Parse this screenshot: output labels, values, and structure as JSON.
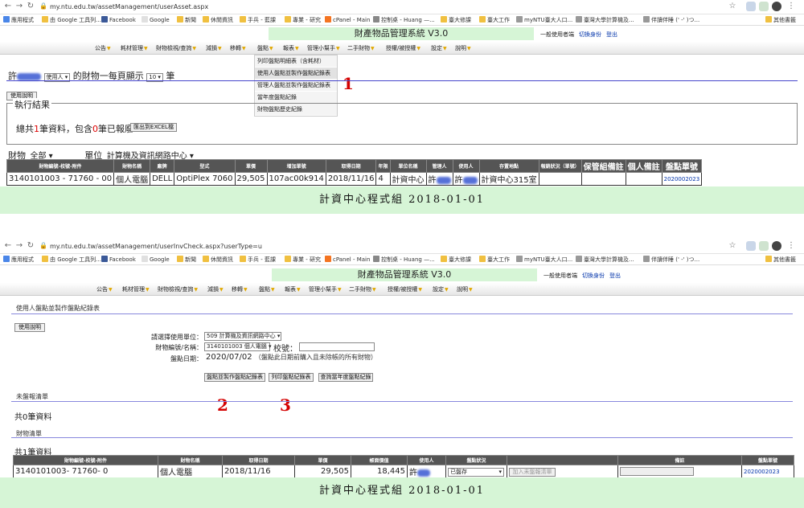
{
  "top": {
    "url": "my.ntu.edu.tw/assetManagement/userAsset.aspx",
    "bookmarks": [
      "應用程式",
      "由 Google 工具列...",
      "Facebook",
      "Google",
      "新聞",
      "休閒資訊",
      "手兵 - 藍課",
      "專業 - 研究",
      "cPanel - Main",
      "控制桌 - Huang —...",
      "臺大修課",
      "臺大工作",
      "myNTU臺大人口...",
      "臺灣大學計算機及...",
      "伴讀伴睡 (' -' )つ...",
      "其他書籤"
    ],
    "title": "財產物品管理系統 V3.0",
    "user_label": "一般使用者端",
    "switch_link": "切換身份",
    "logout_link": "登出",
    "menu": [
      "公告",
      "耗材管理",
      "財物檢視/查詢",
      "減損",
      "移轉",
      "盤點",
      "報表",
      "管理小幫手",
      "二手財物",
      "授權/被授權",
      "設定",
      "說明"
    ],
    "dropdown": [
      "列印盤點明細表（含耗材）",
      "使用人盤點並製作盤點紀錄表",
      "管理人盤點並製作盤點紀錄表",
      "當年度盤點紀錄",
      "財物盤點歷史紀錄"
    ],
    "anno": "1",
    "owner_prefix": "許",
    "role_select": "使用人",
    "owner_mid": "的財物",
    "per_page_label": "一每頁顯示",
    "per_page_value": "10",
    "per_page_unit": "筆",
    "help_btn": "使用說明",
    "result_legend": "執行結果",
    "summary_a": "總共",
    "summary_count": "1",
    "summary_b": "筆資料，包含",
    "summary_scrap": "0",
    "summary_c": "筆已報廢",
    "export_btn": "匯出到EXCEL檔",
    "filter_asset_label": "財物",
    "filter_asset_value": "全部",
    "filter_unit_label": "單位",
    "filter_unit_value": "計算機及資訊網路中心",
    "table_headers": [
      "財物編號-校號-附件",
      "財物名稱",
      "廠牌",
      "型式",
      "單價",
      "增加單號",
      "取得日期",
      "年限",
      "單位名稱",
      "管理人",
      "使用人",
      "存置地點",
      "報銷狀況（單號）"
    ],
    "table_big_headers": [
      "保管組備註",
      "個人備註",
      "盤點單號"
    ],
    "row": [
      "3140101003 - 71760 - 00",
      "個人電腦",
      "DELL",
      "OptiPlex 7060",
      "29,505",
      "107ac00k914",
      "2018/11/16",
      "4",
      "計資中心",
      "許",
      "許",
      "計資中心315室",
      "",
      "",
      "",
      "2020002023"
    ],
    "footer": "計資中心程式組 2018-01-01"
  },
  "bottom": {
    "url": "my.ntu.edu.tw/assetManagement/userInvCheck.aspx?userType=u",
    "title": "財產物品管理系統 V3.0",
    "user_label": "一般使用者端",
    "switch_link": "切換身份",
    "logout_link": "登出",
    "page_heading": "使用人盤點並製作盤點紀錄表",
    "help_btn": "使用說明",
    "unit_label": "請選擇使用單位：",
    "unit_value": "509 計算機及資訊網路中心",
    "asset_label": "財物編號/名稱：",
    "asset_value": "3140101003 個人電腦",
    "school_no_label": "校號：",
    "date_label": "盤點日期：",
    "date_value": "2020/07/02",
    "date_note": "（盤點此日期前購入且未除帳的所有財物）",
    "btn_make": "盤點並製作盤點紀錄表",
    "btn_print": "列印盤點紀錄表",
    "btn_query": "查詢當年度盤點紀錄",
    "anno2": "2",
    "anno3": "3",
    "unchecked_heading": "未盤報清單",
    "unchecked_count": "共0筆資料",
    "list_heading": "財物清單",
    "list_count": "共1筆資料",
    "table_headers": [
      "財物編號-校號-附件",
      "財物名稱",
      "取得日期",
      "單價",
      "帳面價值",
      "使用人",
      "盤點狀況",
      "",
      "備註",
      "盤點單號"
    ],
    "row": [
      "3140101003- 71760- 0",
      "個人電腦",
      "2018/11/16",
      "29,505",
      "18,445",
      "許",
      "已盤存",
      "加入未盤報清單",
      "",
      "2020002023"
    ],
    "footer": "計資中心程式組 2018-01-01"
  }
}
